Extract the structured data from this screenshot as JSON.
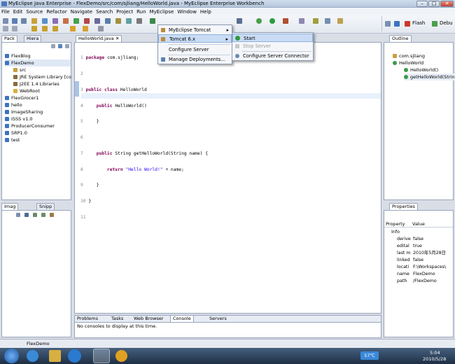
{
  "window": {
    "title": "MyEclipse Java Enterprise - FlexDemo/src/com/sjliang/HelloWorld.java - MyEclipse Enterprise Workbench"
  },
  "menubar": [
    "File",
    "Edit",
    "Source",
    "Refactor",
    "Navigate",
    "Search",
    "Project",
    "Run",
    "MyEclipse",
    "Window",
    "Help"
  ],
  "perspectives": {
    "flash": "Flash",
    "debug": "Debu"
  },
  "package_explorer": {
    "tabs": [
      "Pack",
      "Hiera"
    ],
    "items": [
      {
        "label": "FlexBlog"
      },
      {
        "label": "FlexDemo"
      },
      {
        "label": "src"
      },
      {
        "label": "JRE System Library [co"
      },
      {
        "label": "J2EE 1.4 Libraries"
      },
      {
        "label": "WebRoot"
      },
      {
        "label": "FlexGrocer1"
      },
      {
        "label": "hello"
      },
      {
        "label": "ImageSharing"
      },
      {
        "label": "ISSS v1.0"
      },
      {
        "label": "ProducerConsumer"
      },
      {
        "label": "SRP1.0"
      },
      {
        "label": "test"
      }
    ]
  },
  "editor": {
    "tab": "HelloWorld.java",
    "lines": [
      {
        "n": "1",
        "t": "package com.sjliang;"
      },
      {
        "n": "2",
        "t": ""
      },
      {
        "n": "3",
        "t": "public class HelloWorld"
      },
      {
        "n": "4",
        "t": "    public HelloWorld()"
      },
      {
        "n": "5",
        "t": "    }"
      },
      {
        "n": "6",
        "t": ""
      },
      {
        "n": "7",
        "t": "    public String getHelloWorld(String name) {"
      },
      {
        "n": "8",
        "t": "        return \"Hello World!\" + name;"
      },
      {
        "n": "9",
        "t": "    }"
      },
      {
        "n": "10",
        "t": "}"
      },
      {
        "n": "11",
        "t": ""
      }
    ]
  },
  "myeclipse_menu": {
    "items": [
      "MyEclipse Tomcat",
      "Tomcat 6.x",
      "Configure Server",
      "Manage Deployments..."
    ]
  },
  "tomcat_submenu": {
    "items": [
      "Start",
      "Stop Server",
      "Configure Server Connector"
    ]
  },
  "outline": {
    "tab": "Outline",
    "items": [
      {
        "label": "com.sjliang"
      },
      {
        "label": "HelloWorld"
      },
      {
        "label": "HelloWorld()"
      },
      {
        "label": "getHelloWorld(Strin"
      }
    ]
  },
  "properties": {
    "tab": "Properties",
    "headers": [
      "Property",
      "Value"
    ],
    "group": "Info",
    "rows": [
      {
        "k": "derive",
        "v": "false"
      },
      {
        "k": "edital",
        "v": "true"
      },
      {
        "k": "last m",
        "v": "2010年5月28日"
      },
      {
        "k": "linked",
        "v": "false"
      },
      {
        "k": "locati",
        "v": "F:\\Workspaces\\"
      },
      {
        "k": "name",
        "v": "FlexDemo"
      },
      {
        "k": "path",
        "v": "/FlexDemo"
      }
    ]
  },
  "image_panel": {
    "tabs": [
      "Imag",
      "Snipp"
    ]
  },
  "console_panel": {
    "tabs": [
      "Problems",
      "Tasks",
      "Web Browser",
      "Console",
      "Servers"
    ],
    "message": "No consoles to display at this time."
  },
  "statusbar": {
    "text": "FlexDemo"
  },
  "taskbar": {
    "temp": "57℃",
    "time": "5:04",
    "date": "2010/5/28"
  },
  "colors": {
    "selection": "#c9dcf4",
    "keyword": "#7f0055",
    "string": "#2a00ff"
  }
}
